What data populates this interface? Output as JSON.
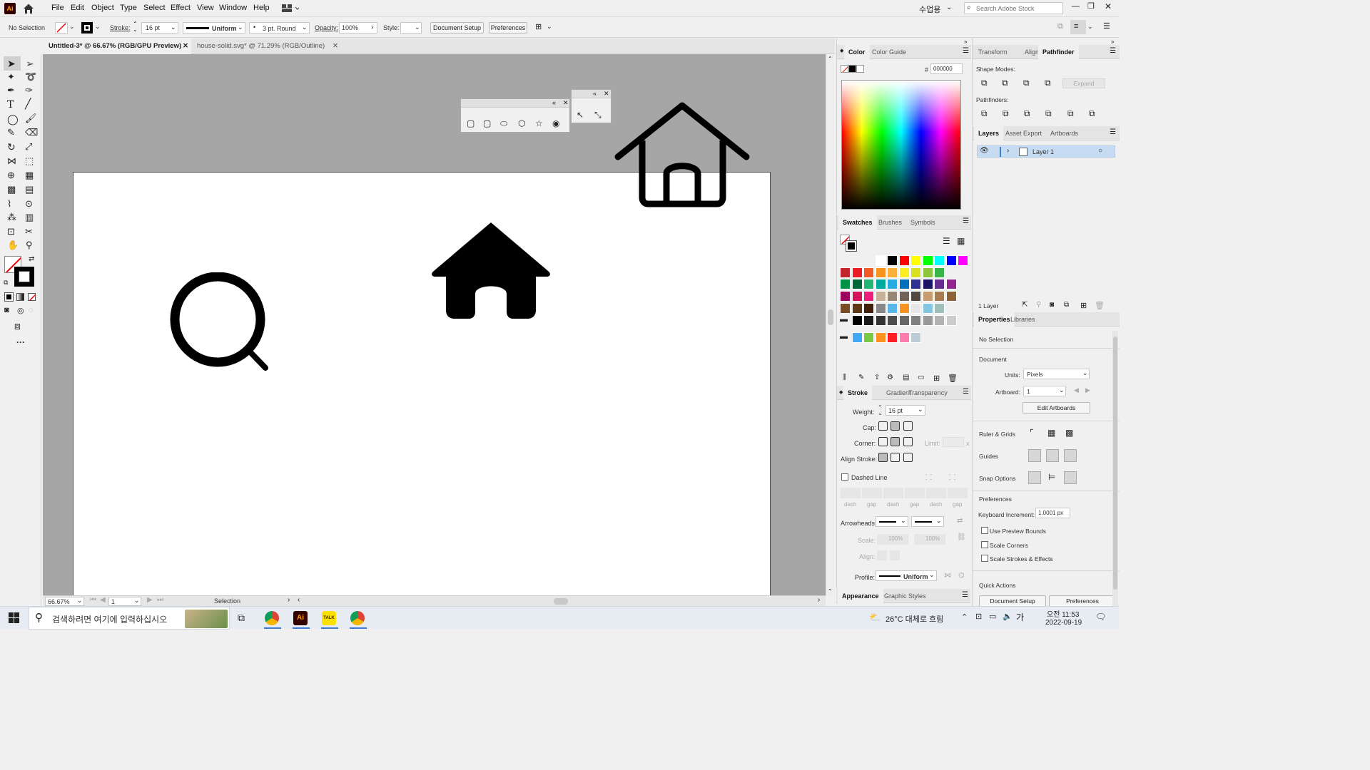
{
  "app": {
    "logo": "Ai"
  },
  "menu": [
    "File",
    "Edit",
    "Object",
    "Type",
    "Select",
    "Effect",
    "View",
    "Window",
    "Help"
  ],
  "topright": {
    "workspace": "수업용",
    "search_placeholder": "Search Adobe Stock"
  },
  "control": {
    "selection": "No Selection",
    "stroke_label": "Stroke:",
    "stroke_weight": "16 pt",
    "profile": "Uniform",
    "brush": "3 pt. Round",
    "opacity_label": "Opacity:",
    "opacity": "100%",
    "style_label": "Style:",
    "doc_setup": "Document Setup",
    "preferences": "Preferences"
  },
  "tabs": [
    {
      "label": "Untitled-3* @ 66.67% (RGB/GPU Preview)"
    },
    {
      "label": "house-solid.svg* @ 71.29% (RGB/Outline)"
    }
  ],
  "status": {
    "zoom": "66.67%",
    "artboard": "1",
    "tool": "Selection"
  },
  "color_panel": {
    "tabs": [
      "Color",
      "Color Guide"
    ],
    "hex_label": "#",
    "hex": "000000"
  },
  "swatches_panel": {
    "tabs": [
      "Swatches",
      "Brushes",
      "Symbols"
    ],
    "rows": [
      [
        "#ffffff",
        "#000000",
        "#ff0000",
        "#ffff00",
        "#00ff00",
        "#00ffff",
        "#0000ff",
        "#ff00ff"
      ],
      [
        "#c1272d",
        "#ed1c24",
        "#f15a24",
        "#f7931e",
        "#fbb03b",
        "#fcee21",
        "#d9e021",
        "#8cc63f",
        "#39b54a"
      ],
      [
        "#009245",
        "#006837",
        "#22b573",
        "#00a99d",
        "#29abe2",
        "#0071bc",
        "#2e3192",
        "#1b1464",
        "#662d91",
        "#93278f"
      ],
      [
        "#9e005d",
        "#d4145a",
        "#ed1e79",
        "#c7b299",
        "#998675",
        "#736357",
        "#534741",
        "#c69c6d",
        "#a67c52",
        "#8c6239"
      ],
      [
        "#754c24",
        "#603813",
        "#42210b",
        "#888888",
        "#5bb6e8",
        "#f7931e",
        "#e6e6e6",
        "#86c5e0",
        "#9ec0b8"
      ],
      [
        "#000000",
        "#1a1a1a",
        "#333333",
        "#4d4d4d",
        "#666666",
        "#808080",
        "#999999",
        "#b3b3b3",
        "#cccccc"
      ],
      [
        "#3fa9f5",
        "#7ac943",
        "#ff931e",
        "#ff1d25",
        "#ff7bac",
        "#bdccd4"
      ]
    ]
  },
  "stroke_panel": {
    "tabs": [
      "Stroke",
      "Gradient",
      "Transparency"
    ],
    "weight_label": "Weight:",
    "weight": "16 pt",
    "cap_label": "Cap:",
    "corner_label": "Corner:",
    "limit_label": "Limit:",
    "limit_x": "x",
    "align_label": "Align Stroke:",
    "dashed": "Dashed Line",
    "dash_labels": [
      "dash",
      "gap",
      "dash",
      "gap",
      "dash",
      "gap"
    ],
    "arrowheads_label": "Arrowheads:",
    "scale_label": "Scale:",
    "scale1": "100%",
    "scale2": "100%",
    "align2_label": "Align:",
    "profile_label": "Profile:",
    "profile": "Uniform"
  },
  "appearance_tabs": [
    "Appearance",
    "Graphic Styles"
  ],
  "pathfinder_panel": {
    "tabs": [
      "Transform",
      "Align",
      "Pathfinder"
    ],
    "shape_modes": "Shape Modes:",
    "expand": "Expand",
    "pathfinders": "Pathfinders:"
  },
  "layers_panel": {
    "tabs": [
      "Layers",
      "Asset Export",
      "Artboards"
    ],
    "layer": "Layer 1",
    "count": "1 Layer"
  },
  "properties_panel": {
    "tabs": [
      "Properties",
      "Libraries"
    ],
    "selection": "No Selection",
    "document": "Document",
    "units_label": "Units:",
    "units": "Pixels",
    "artboard_label": "Artboard:",
    "artboard": "1",
    "edit_artboards": "Edit Artboards",
    "rulers": "Ruler & Grids",
    "guides": "Guides",
    "snap": "Snap Options",
    "preferences": "Preferences",
    "kb_label": "Keyboard Increment:",
    "kb": "1.0001 px",
    "chk1": "Use Preview Bounds",
    "chk2": "Scale Corners",
    "chk3": "Scale Strokes & Effects",
    "quick": "Quick Actions",
    "qa1": "Document Setup",
    "qa2": "Preferences"
  },
  "taskbar": {
    "search": "검색하려면 여기에 입력하십시오",
    "weather": "26°C 대체로 흐림",
    "time": "오전 11:53",
    "date": "2022-09-19",
    "ime": "가",
    "talk": "TALK"
  }
}
